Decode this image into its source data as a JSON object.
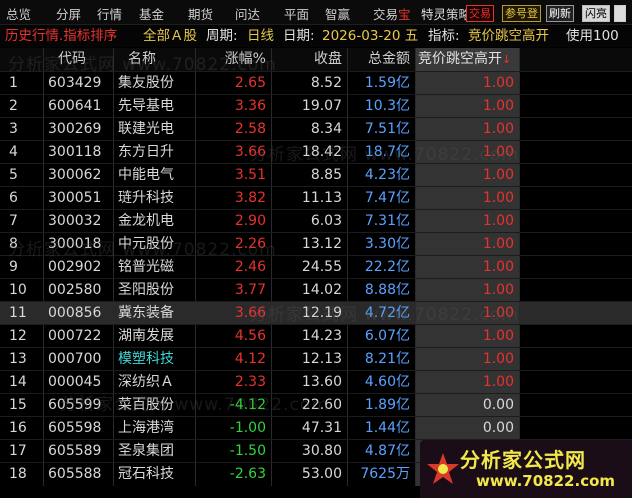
{
  "menu": {
    "items": [
      "总览",
      "分屏",
      "行情",
      "基金",
      "期货",
      "问达",
      "平面",
      "智赢",
      "交易",
      "宝"
    ],
    "special_text": "特灵",
    "strategy_text": "策略",
    "buttons": [
      "交易",
      "参号登",
      "刷新",
      "闪亮"
    ]
  },
  "infobar": {
    "title": "历史行情.指标排序",
    "scope": "全部Ａ股",
    "period_label": "周期:",
    "period_value": "日线",
    "date_label": "日期:",
    "date_value": "2026-03-20 五",
    "indicator_label": "指标:",
    "indicator_value": "竞价跳空高开",
    "usage": "使用100"
  },
  "table": {
    "headers": {
      "code": "代码",
      "name": "名称",
      "change": "涨幅%",
      "close": "收盘",
      "amount": "总金额",
      "indicator": "竞价跳空高开",
      "sort_arrow": "↓"
    },
    "rows": [
      {
        "idx": "1",
        "code": "603429",
        "name": "集友股份",
        "r": "R",
        "change": "2.65",
        "close": "8.52",
        "amount": "1.59亿",
        "val": "1.00"
      },
      {
        "idx": "2",
        "code": "600641",
        "name": "先导基电",
        "r": "R",
        "change": "3.36",
        "close": "19.07",
        "amount": "10.3亿",
        "val": "1.00"
      },
      {
        "idx": "3",
        "code": "300269",
        "name": "联建光电",
        "r": "",
        "change": "2.58",
        "close": "8.34",
        "amount": "7.51亿",
        "val": "1.00"
      },
      {
        "idx": "4",
        "code": "300118",
        "name": "东方日升",
        "r": "R",
        "change": "3.66",
        "close": "18.42",
        "amount": "18.7亿",
        "val": "1.00"
      },
      {
        "idx": "5",
        "code": "300062",
        "name": "中能电气",
        "r": "",
        "change": "3.51",
        "close": "8.85",
        "amount": "4.23亿",
        "val": "1.00"
      },
      {
        "idx": "6",
        "code": "300051",
        "name": "琏升科技",
        "r": "",
        "change": "3.82",
        "close": "11.13",
        "amount": "7.47亿",
        "val": "1.00"
      },
      {
        "idx": "7",
        "code": "300032",
        "name": "金龙机电",
        "r": "",
        "change": "2.90",
        "close": "6.03",
        "amount": "7.31亿",
        "val": "1.00"
      },
      {
        "idx": "8",
        "code": "300018",
        "name": "中元股份",
        "r": "R",
        "change": "2.26",
        "close": "13.12",
        "amount": "3.30亿",
        "val": "1.00"
      },
      {
        "idx": "9",
        "code": "002902",
        "name": "铭普光磁",
        "r": "R",
        "change": "2.46",
        "close": "24.55",
        "amount": "22.2亿",
        "val": "1.00"
      },
      {
        "idx": "10",
        "code": "002580",
        "name": "圣阳股份",
        "r": "R",
        "change": "3.77",
        "close": "14.02",
        "amount": "8.88亿",
        "val": "1.00"
      },
      {
        "idx": "11",
        "code": "000856",
        "name": "冀东装备",
        "r": "",
        "change": "3.66",
        "close": "12.19",
        "amount": "4.72亿",
        "val": "1.00"
      },
      {
        "idx": "12",
        "code": "000722",
        "name": "湖南发展",
        "r": "R",
        "change": "4.56",
        "close": "14.23",
        "amount": "6.07亿",
        "val": "1.00"
      },
      {
        "idx": "13",
        "code": "000700",
        "name": "模塑科技",
        "r": "R",
        "change": "4.12",
        "close": "12.13",
        "amount": "8.21亿",
        "val": "1.00"
      },
      {
        "idx": "14",
        "code": "000045",
        "name": "深纺织Ａ",
        "r": "",
        "change": "2.33",
        "close": "13.60",
        "amount": "4.60亿",
        "val": "1.00"
      },
      {
        "idx": "15",
        "code": "605599",
        "name": "菜百股份",
        "r": "",
        "change": "-4.12",
        "close": "22.60",
        "amount": "1.89亿",
        "val": "0.00"
      },
      {
        "idx": "16",
        "code": "605598",
        "name": "上海港湾",
        "r": "",
        "change": "-1.00",
        "close": "47.31",
        "amount": "1.44亿",
        "val": "0.00"
      },
      {
        "idx": "17",
        "code": "605589",
        "name": "圣泉集团",
        "r": "R",
        "change": "-1.50",
        "close": "30.80",
        "amount": "4.87亿",
        "val": "0.00"
      },
      {
        "idx": "18",
        "code": "605588",
        "name": "冠石科技",
        "r": "",
        "change": "-2.63",
        "close": "53.00",
        "amount": "7625万",
        "val": "0.00"
      }
    ]
  },
  "watermark": {
    "text": "分析家公式网 www.70822.com"
  },
  "logo": {
    "title": "分析家公式网",
    "url": "www.70822.com"
  },
  "colors": {
    "up": "#e8322e",
    "down": "#33d33a",
    "amount": "#5aa2ff",
    "highlight_name": "#3fd6d6",
    "logo_text": "#f2e84a"
  }
}
